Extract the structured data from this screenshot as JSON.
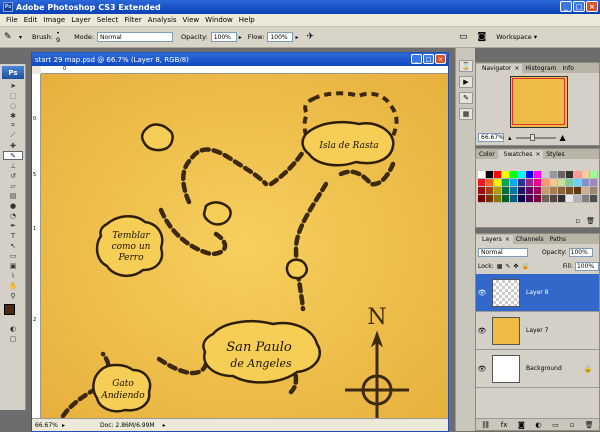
{
  "app": {
    "title": "Adobe Photoshop CS3 Extended",
    "logo": "Ps",
    "window_buttons": [
      "_",
      "□",
      "×"
    ]
  },
  "menu": [
    "File",
    "Edit",
    "Image",
    "Layer",
    "Select",
    "Filter",
    "Analysis",
    "View",
    "Window",
    "Help"
  ],
  "options": {
    "brush_label": "Brush:",
    "brush_size": "9",
    "mode_label": "Mode:",
    "mode_value": "Normal",
    "opacity_label": "Opacity:",
    "opacity_value": "100%",
    "flow_label": "Flow:",
    "flow_value": "100%",
    "workspace_label": "Workspace"
  },
  "document": {
    "title": "start 29 map.psd @ 66.7% (Layer 8, RGB/8)",
    "zoom": "66.67%",
    "doc_size": "Doc: 2.86M/6.99M",
    "ruler_top": [
      "0"
    ],
    "ruler_left": [
      "0",
      "5",
      "1",
      "2"
    ]
  },
  "map": {
    "islands": [
      {
        "name": "Isla de Rasta"
      },
      {
        "name": "Temblar como un Perro",
        "lines": [
          "Temblar",
          "como un",
          "Perro"
        ]
      },
      {
        "name": "San Paulo de Angeles",
        "lines": [
          "San Paulo",
          "de Angeles"
        ]
      },
      {
        "name": "Gato Andiendo",
        "lines": [
          "Gato",
          "Andiendo"
        ]
      }
    ],
    "compass_letter": "N"
  },
  "navigator": {
    "tabs": [
      "Navigator",
      "Histogram",
      "Info"
    ],
    "zoom": "66.67%"
  },
  "swatches": {
    "tabs": [
      "Color",
      "Swatches",
      "Styles"
    ],
    "colors": [
      "#ffffff",
      "#000000",
      "#ff0000",
      "#ffff00",
      "#00ff00",
      "#00ffff",
      "#0000ff",
      "#ff00ff",
      "#cccccc",
      "#999999",
      "#666666",
      "#333333",
      "#ff9999",
      "#ffcc99",
      "#99ff99",
      "#ed1c24",
      "#f26522",
      "#fff200",
      "#00a651",
      "#00aeef",
      "#2e3192",
      "#92278f",
      "#ec008c",
      "#f7977a",
      "#fdc68a",
      "#c4df9b",
      "#82ca9c",
      "#6ecff6",
      "#8393ca",
      "#a187be",
      "#9e0b0f",
      "#a0410d",
      "#aba000",
      "#007236",
      "#0076a3",
      "#1b1464",
      "#630460",
      "#9e005d",
      "#c69c6d",
      "#a67c52",
      "#8c6239",
      "#754c24",
      "#603913",
      "#c7b299",
      "#998675",
      "#790000",
      "#7b2e00",
      "#827b00",
      "#005e20",
      "#005b7f",
      "#0d004c",
      "#4b0049",
      "#7b0046",
      "#736357",
      "#534741",
      "#362f2d",
      "#e6e6e6",
      "#b3b3b3",
      "#808080",
      "#4d4d4d"
    ]
  },
  "layers": {
    "tabs": [
      "Layers",
      "Channels",
      "Paths"
    ],
    "blend": "Normal",
    "opacity_label": "Opacity:",
    "opacity_value": "100%",
    "lock_label": "Lock:",
    "fill_label": "Fill:",
    "fill_value": "100%",
    "items": [
      {
        "name": "Layer 8",
        "selected": true
      },
      {
        "name": "Layer 7",
        "selected": false
      },
      {
        "name": "Background",
        "selected": false
      }
    ]
  }
}
